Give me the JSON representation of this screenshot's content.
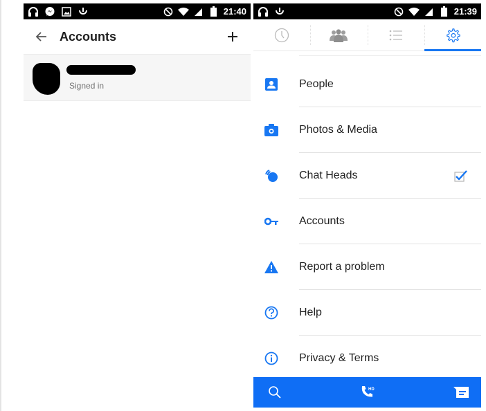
{
  "left_screen": {
    "status_bar": {
      "notification_icons": [
        "headphones-icon",
        "messenger-icon",
        "image-icon",
        "loading-icon"
      ],
      "system_icons": [
        "do-not-disturb-icon",
        "wifi-icon",
        "signal-icon",
        "battery-icon"
      ],
      "time": "21:40"
    },
    "header": {
      "back_icon": "arrow-left-icon",
      "title": "Accounts",
      "add_icon": "plus-icon"
    },
    "accounts": [
      {
        "name": "[redacted]",
        "status": "Signed in"
      }
    ]
  },
  "right_screen": {
    "status_bar": {
      "notification_icons": [
        "headphones-icon",
        "loading-icon"
      ],
      "system_icons": [
        "do-not-disturb-icon",
        "wifi-icon",
        "signal-icon",
        "battery-icon"
      ],
      "time": "21:39"
    },
    "tabs": [
      {
        "icon": "clock-icon",
        "active": false
      },
      {
        "icon": "people-group-icon",
        "active": false
      },
      {
        "icon": "list-icon",
        "active": false
      },
      {
        "icon": "gear-icon",
        "active": true
      }
    ],
    "settings_items": [
      {
        "icon": "contact-card-icon",
        "label": "People"
      },
      {
        "icon": "camera-icon",
        "label": "Photos & Media"
      },
      {
        "icon": "chat-heads-icon",
        "label": "Chat Heads",
        "checked": true
      },
      {
        "icon": "key-icon",
        "label": "Accounts"
      },
      {
        "icon": "warning-icon",
        "label": "Report a problem"
      },
      {
        "icon": "help-icon",
        "label": "Help"
      },
      {
        "icon": "info-icon",
        "label": "Privacy & Terms"
      }
    ],
    "bottom_bar": {
      "buttons": [
        "search-icon",
        "hd-call-icon",
        "compose-message-icon"
      ]
    },
    "colors": {
      "accent": "#1877f2",
      "bottom_bar": "#0f6ef5",
      "tab_inactive": "#b0b0b0"
    }
  }
}
